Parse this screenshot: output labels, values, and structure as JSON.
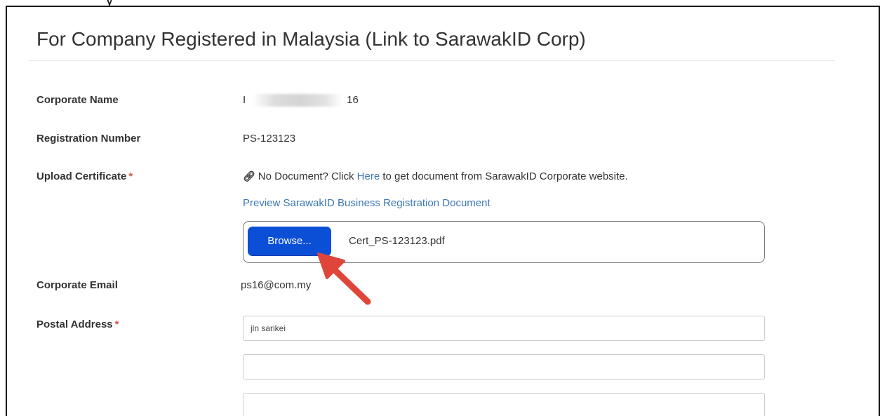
{
  "top_fragment": "y",
  "section": {
    "title": "For Company Registered in Malaysia (Link to SarawakID Corp)"
  },
  "fields": {
    "corporate_name": {
      "label": "Corporate Name",
      "value_prefix": "I",
      "value_suffix": "16"
    },
    "registration_number": {
      "label": "Registration Number",
      "value": "PS-123123"
    },
    "upload_certificate": {
      "label": "Upload Certificate",
      "required_mark": "*",
      "help_prefix": "No Document? Click",
      "help_link": "Here",
      "help_suffix": "to get document from SarawakID Corporate website.",
      "preview_link": "Preview SarawakID Business Registration Document",
      "browse_label": "Browse...",
      "file_name": "Cert_PS-123123.pdf"
    },
    "corporate_email": {
      "label": "Corporate Email",
      "value": "ps16@com.my"
    },
    "postal_address": {
      "label": "Postal Address",
      "required_mark": "*",
      "line1": "jln sarikei",
      "line2": "",
      "line3": ""
    }
  },
  "icons": {
    "help_link_icon": "link-icon",
    "annotation": "red-arrow-icon"
  },
  "colors": {
    "browse_button": "#0b4fd6",
    "link": "#3c78b5",
    "required": "#d9534f",
    "annotation_arrow": "#e0453a"
  }
}
